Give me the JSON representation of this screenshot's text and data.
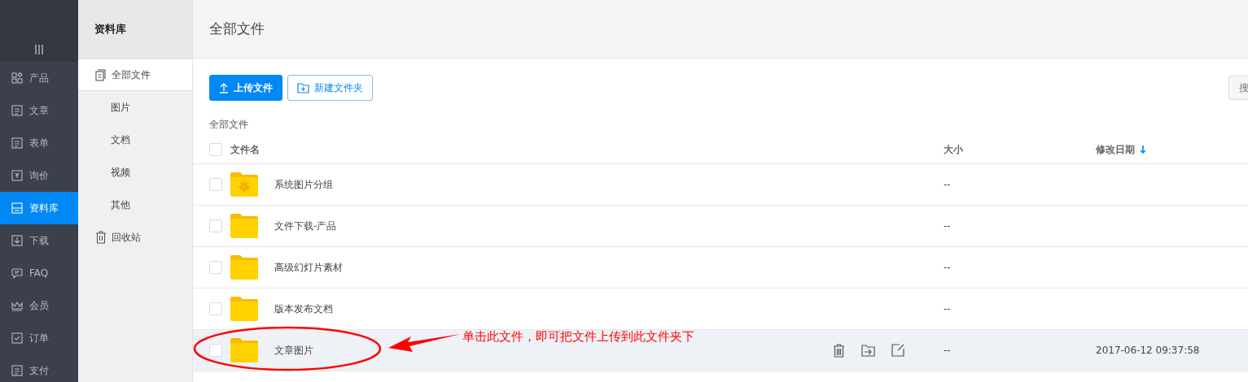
{
  "nav": {
    "items": [
      {
        "label": "产品",
        "selected": false
      },
      {
        "label": "文章",
        "selected": false
      },
      {
        "label": "表单",
        "selected": false
      },
      {
        "label": "询价",
        "selected": false
      },
      {
        "label": "资料库",
        "selected": true
      },
      {
        "label": "下载",
        "selected": false
      },
      {
        "label": "FAQ",
        "selected": false
      },
      {
        "label": "会员",
        "selected": false
      },
      {
        "label": "订单",
        "selected": false
      },
      {
        "label": "支付",
        "selected": false
      }
    ]
  },
  "subnav": {
    "title": "资料库",
    "items": [
      {
        "label": "全部文件",
        "selected": true,
        "kind": "icon"
      },
      {
        "label": "图片",
        "selected": false,
        "kind": "plain"
      },
      {
        "label": "文档",
        "selected": false,
        "kind": "plain"
      },
      {
        "label": "视频",
        "selected": false,
        "kind": "plain"
      },
      {
        "label": "其他",
        "selected": false,
        "kind": "plain"
      },
      {
        "label": "回收站",
        "selected": false,
        "kind": "icon"
      }
    ]
  },
  "header": {
    "title": "全部文件"
  },
  "toolbar": {
    "upload": "上传文件",
    "new_folder": "新建文件夹",
    "search": {
      "placeholder": "搜"
    }
  },
  "breadcrumb": "全部文件",
  "table": {
    "columns": [
      "文件名",
      "大小",
      "修改日期"
    ],
    "select_all_checked": false,
    "rows": [
      {
        "name": "系统图片分组",
        "kind": "system",
        "size": "--",
        "highlighted": false,
        "checked": false
      },
      {
        "name": "文件下载-产品",
        "kind": "folder",
        "size": "--",
        "highlighted": false,
        "checked": false
      },
      {
        "name": "高级幻灯片素材",
        "kind": "folder",
        "size": "--",
        "highlighted": false,
        "checked": false
      },
      {
        "name": "版本发布文档",
        "kind": "folder",
        "size": "--",
        "highlighted": false,
        "checked": false
      },
      {
        "name": "文章图片",
        "kind": "folder",
        "size": "--",
        "date": "2017-06-12 09:37:58",
        "highlighted": true,
        "checked": false
      }
    ]
  },
  "annotation": {
    "text": "单击此文件，即可把文件上传到此文件夹下"
  }
}
